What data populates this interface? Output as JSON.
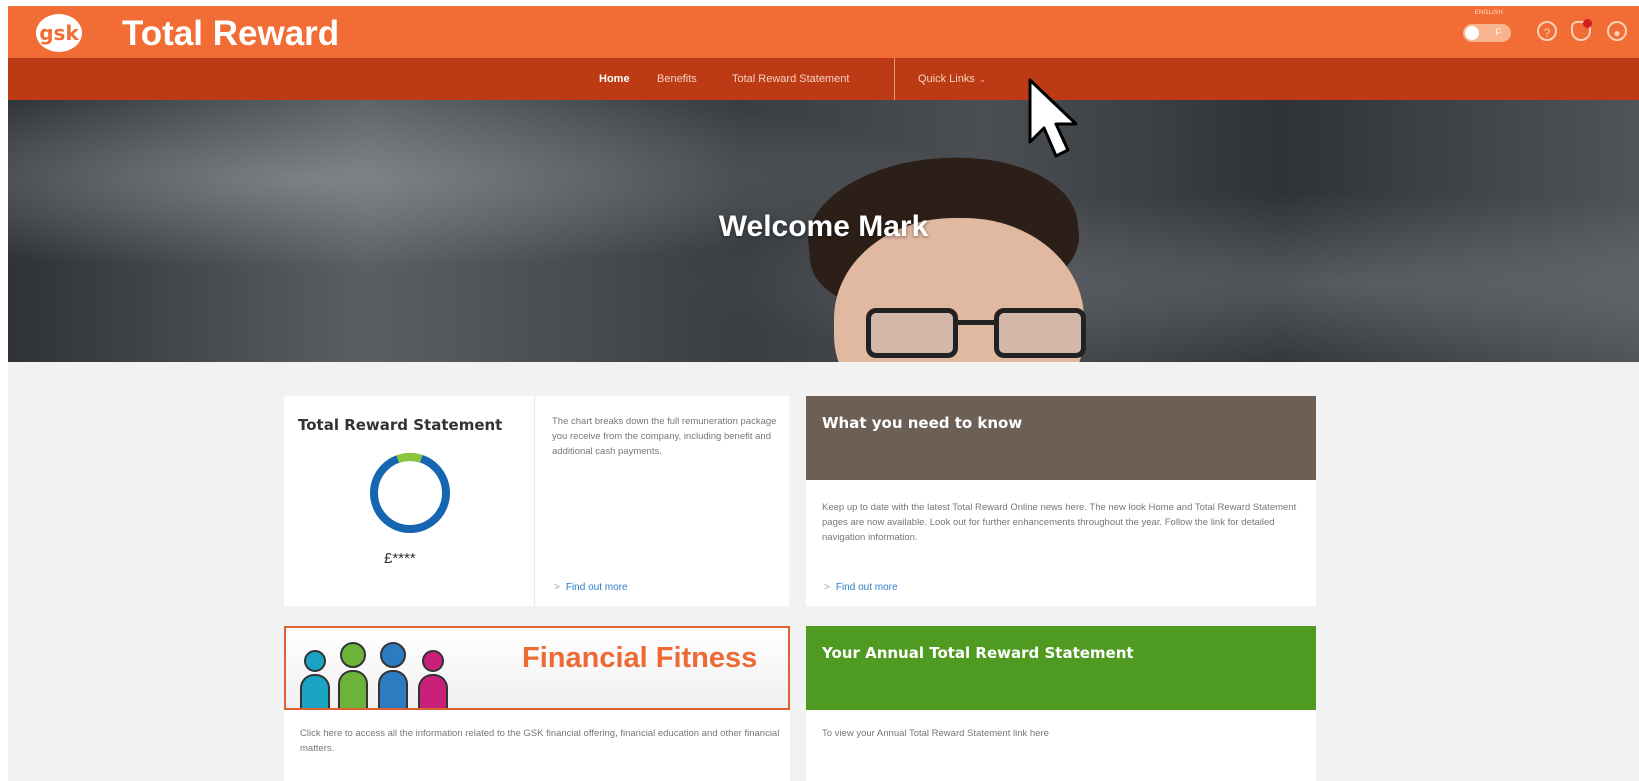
{
  "header": {
    "logo_text": "gsk",
    "app_title": "Total Reward",
    "toggle_label": "ENGLISH",
    "toggle_value": "F"
  },
  "nav": {
    "items": [
      {
        "label": "Home",
        "active": true
      },
      {
        "label": "Benefits",
        "active": false
      },
      {
        "label": "Total Reward Statement",
        "active": false
      }
    ],
    "quick_links": "Quick Links"
  },
  "hero": {
    "title": "Welcome Mark"
  },
  "trs_card": {
    "title": "Total Reward Statement",
    "amount": "£****",
    "description": "The chart breaks down the full remuneration package you receive from the company, including benefit and additional cash payments.",
    "link": "Find out more"
  },
  "know_card": {
    "title": "What you need to know",
    "body": "Keep up to date with the latest Total Reward Online news here. The new look Home and Total Reward Statement pages are now available. Look out for further enhancements throughout the year. Follow the link for detailed navigation information.",
    "link": "Find out more"
  },
  "ff_card": {
    "banner_title": "Financial Fitness",
    "body": "Click here to access all the information related to the GSK financial offering, financial education and other financial matters."
  },
  "annual_card": {
    "title": "Your Annual Total Reward Statement",
    "body": "To view your Annual Total Reward Statement link here"
  },
  "icons": {
    "help": "help-icon",
    "notifications": "bell-icon",
    "account": "user-icon"
  },
  "colors": {
    "brand_orange": "#f26c35",
    "nav_dark_orange": "#bc3b14",
    "know_header": "#6e5f55",
    "annual_header": "#4f9b22",
    "link_blue": "#2c7bc8",
    "donut_blue": "#1565b0",
    "donut_green": "#8cc63f"
  }
}
